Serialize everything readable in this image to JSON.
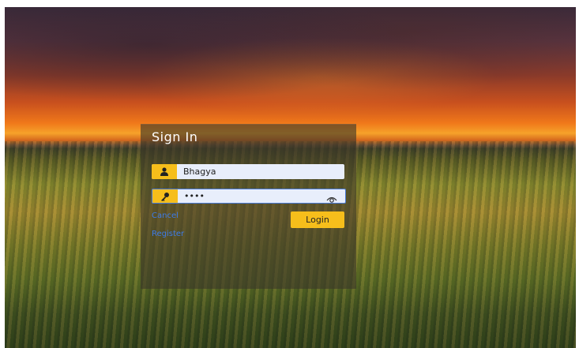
{
  "login": {
    "title": "Sign In",
    "username": {
      "value": "Bhagya",
      "icon": "user-icon"
    },
    "password": {
      "value": "••••",
      "icon": "key-icon",
      "toggle_icon": "eye-icon"
    },
    "cancel_label": "Cancel",
    "register_label": "Register",
    "login_label": "Login"
  },
  "colors": {
    "accent": "#f6be1b",
    "link": "#3d7be6",
    "field_bg": "#e8eefb"
  }
}
